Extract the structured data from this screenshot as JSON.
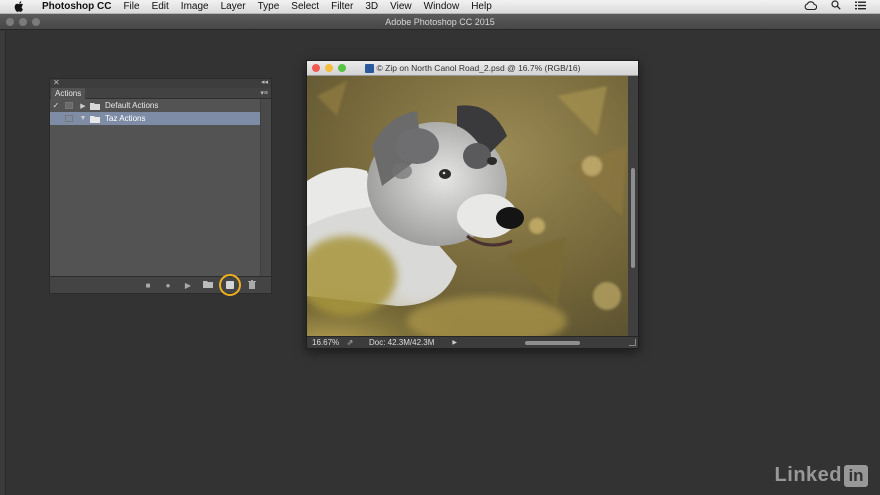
{
  "menubar": {
    "app_name": "Photoshop CC",
    "items": [
      "File",
      "Edit",
      "Image",
      "Layer",
      "Type",
      "Select",
      "Filter",
      "3D",
      "View",
      "Window",
      "Help"
    ],
    "right_icons": [
      "creative-cloud-icon",
      "search-icon",
      "notification-list-icon"
    ]
  },
  "app": {
    "title": "Adobe Photoshop CC 2015"
  },
  "actions_panel": {
    "tab_label": "Actions",
    "rows": [
      {
        "checked": "✓",
        "name": "Default Actions",
        "expanded": false,
        "selected": false
      },
      {
        "checked": "",
        "name": "Taz Actions",
        "expanded": true,
        "selected": true
      }
    ],
    "footer_icons": [
      "stop-icon",
      "record-icon",
      "play-icon",
      "folder-icon",
      "new-action-icon",
      "trash-icon"
    ]
  },
  "document": {
    "title": "© Zip on North Canol Road_2.psd @ 16.7% (RGB/16)",
    "zoom": "16.67%",
    "doc_info": "Doc: 42.3M/42.3M"
  },
  "watermark": {
    "text": "Linked",
    "box": "in"
  },
  "colors": {
    "highlight": "#f0b020",
    "selection": "#7f8ca6"
  }
}
